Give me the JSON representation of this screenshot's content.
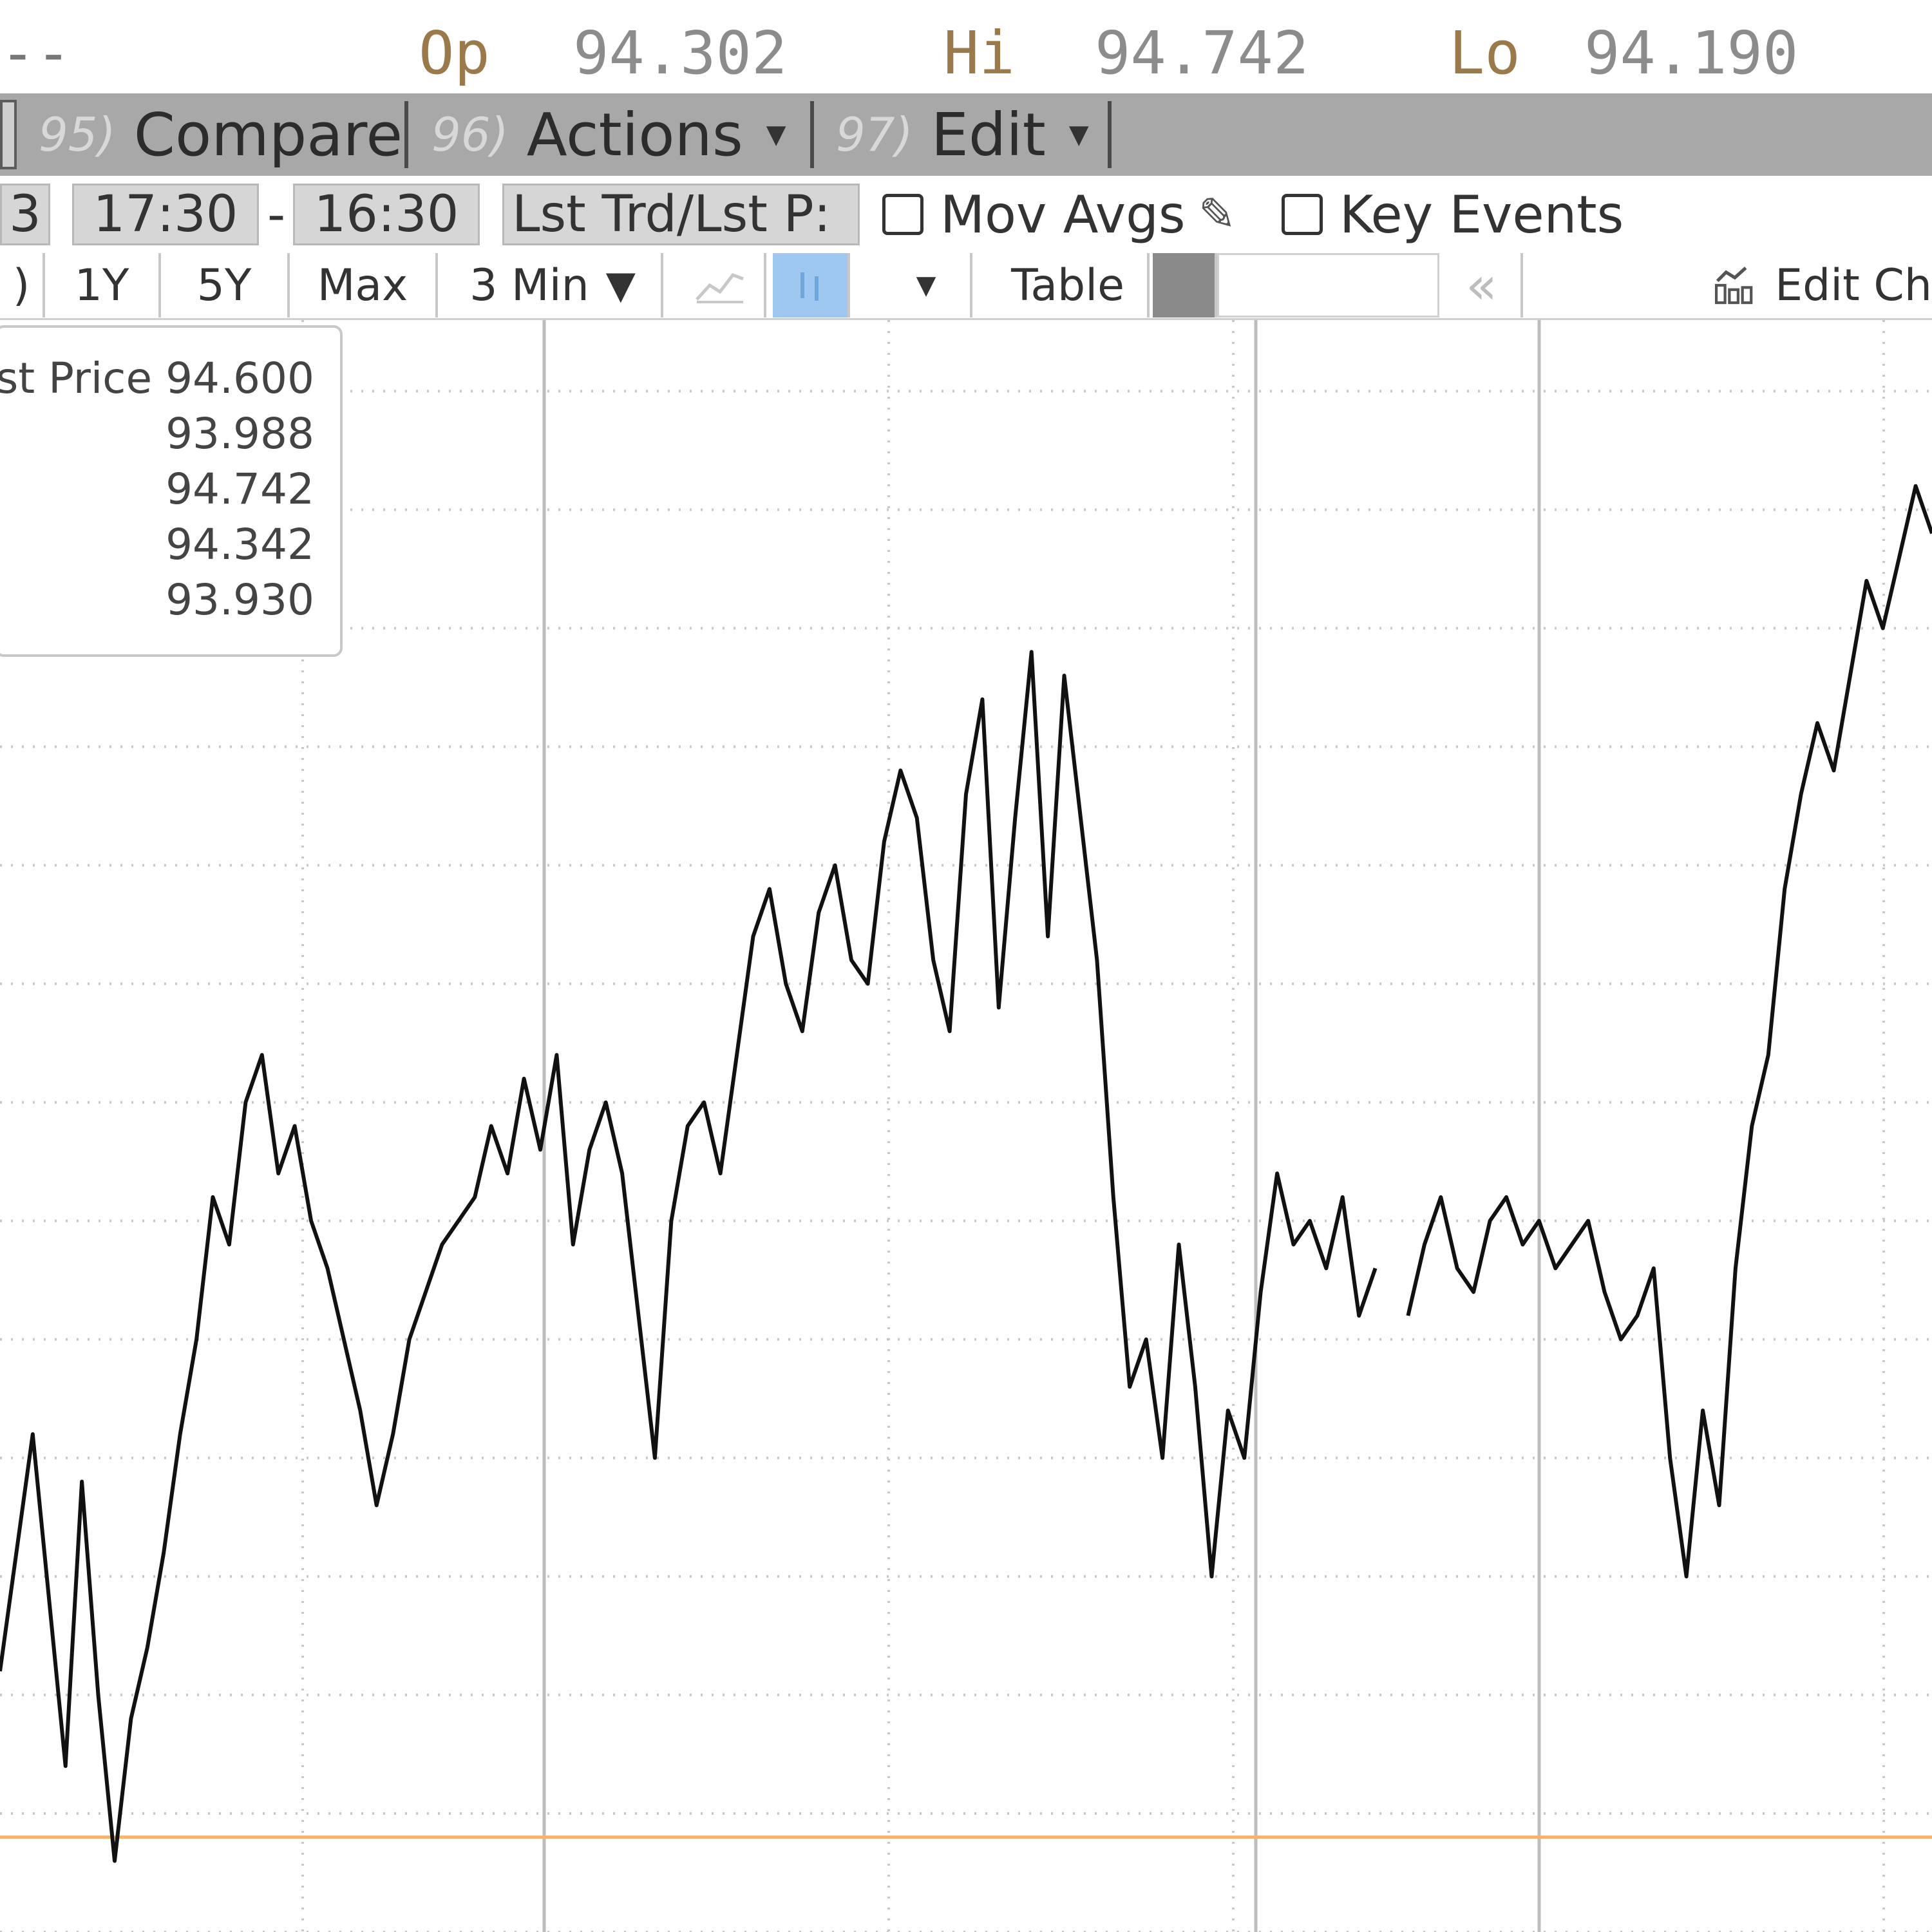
{
  "quote": {
    "dashes": "--",
    "open_label": "Op",
    "open_value": "94.302",
    "high_label": "Hi",
    "high_value": "94.742",
    "low_label": "Lo",
    "low_value": "94.190"
  },
  "menu": {
    "items": [
      {
        "num": "95)",
        "label": "Compare",
        "has_caret": false
      },
      {
        "num": "96)",
        "label": "Actions",
        "has_caret": true
      },
      {
        "num": "97)",
        "label": "Edit",
        "has_caret": true
      }
    ]
  },
  "toolbar1": {
    "date_stub": "3",
    "start_time": "17:30",
    "range_separator": "-",
    "end_time": "16:30",
    "price_field": "Lst Trd/Lst P:",
    "mov_avgs_label": "Mov Avgs",
    "mov_avgs_checked": false,
    "key_events_label": "Key Events",
    "key_events_checked": false
  },
  "toolbar2": {
    "periods": [
      ")",
      "1Y",
      "5Y",
      "Max"
    ],
    "interval": "3 Min",
    "table_label": "Table",
    "back_label": "«",
    "edit_chart_label": "Edit Ch"
  },
  "legend": {
    "title": "st Price",
    "values": [
      "94.600",
      "93.988",
      "94.742",
      "94.342",
      "93.930"
    ]
  },
  "chart_data": {
    "type": "line",
    "series": [
      {
        "values": [
          94.26,
          94.31,
          94.36,
          94.29,
          94.22,
          94.34,
          94.25,
          94.18,
          94.24,
          94.27,
          94.31,
          94.36,
          94.4,
          94.46,
          94.44,
          94.5,
          94.52,
          94.47,
          94.49,
          94.45,
          94.43,
          94.4,
          94.37,
          94.33,
          94.36,
          94.4,
          94.42,
          94.44,
          94.45,
          94.46,
          94.49,
          94.47,
          94.51,
          94.48,
          94.52,
          94.44,
          94.48,
          94.5,
          94.47,
          94.41,
          94.35,
          94.45,
          94.49,
          94.5,
          94.47,
          94.52,
          94.57,
          94.59,
          94.55,
          94.53,
          94.58,
          94.6,
          94.56,
          94.55,
          94.61,
          94.64,
          94.62,
          94.56,
          94.53,
          94.63,
          94.67,
          94.54,
          94.62,
          94.69,
          94.57,
          94.68,
          94.62,
          94.56,
          94.46,
          94.38,
          94.4,
          94.35,
          94.44,
          94.38,
          94.3,
          94.37,
          94.35,
          94.42,
          94.47,
          94.44,
          94.45,
          94.43,
          94.46,
          94.41,
          94.43,
          null,
          94.41,
          94.44,
          94.46,
          94.43,
          94.42,
          94.45,
          94.46,
          94.44,
          94.45,
          94.43,
          94.44,
          94.45,
          94.42,
          94.4,
          94.41,
          94.43,
          94.35,
          94.3,
          94.37,
          94.33,
          94.43,
          94.49,
          94.52,
          94.59,
          94.63,
          94.66,
          94.64,
          94.68,
          94.72,
          94.7,
          94.73,
          94.76,
          94.74
        ]
      }
    ],
    "reference_line": 94.19,
    "ylim": [
      94.15,
      94.83
    ],
    "grid": true,
    "colors": {
      "line": "#111111",
      "reference": "#f5b26b",
      "grid": "#c8c8c8"
    }
  }
}
